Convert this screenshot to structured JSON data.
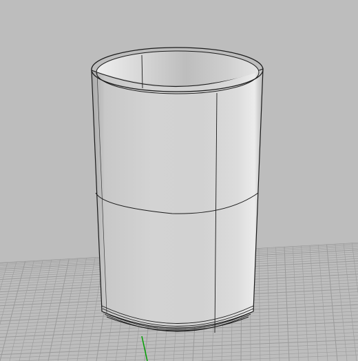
{
  "viewport": {
    "background_color": "#bdbdbd",
    "projection": "perspective",
    "grid_visible": true,
    "grid_line_color": "#9a9a9a",
    "grid_axis_y_color": "#00a000"
  },
  "model": {
    "shape": "hollow cylinder shell",
    "shaded": true,
    "edges_visible": true,
    "outer_color": "#d4d4d4",
    "inner_color": "#c8c8c8",
    "edge_color": "#1a1a1a"
  }
}
